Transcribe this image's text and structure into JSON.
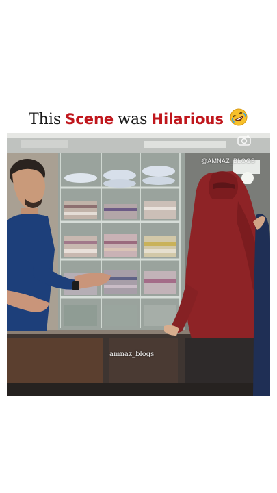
{
  "caption": {
    "word_this": "This",
    "word_scene": "Scene",
    "word_was": "was",
    "word_hilarious": "Hilarious",
    "emoji_icon": "rolling-on-floor-laughing-emoji-icon",
    "colors": {
      "normal": "#1a1a1a",
      "highlight": "#c0161c"
    }
  },
  "video": {
    "handle_overlay": "@AMNAZ_BLOGS",
    "watermark": "amnaz_blogs",
    "camera_icon": "camera-icon"
  }
}
